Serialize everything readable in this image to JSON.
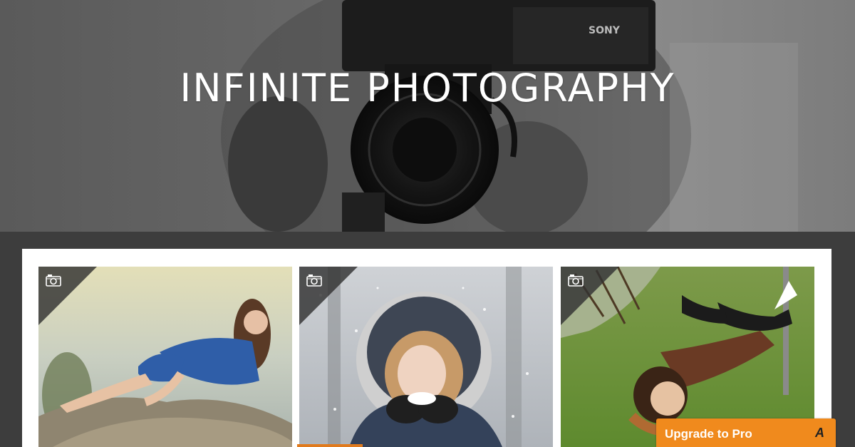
{
  "hero": {
    "title": "INFINITE PHOTOGRAPHY",
    "camera_brand": "SONY"
  },
  "gallery": {
    "items": [
      {
        "icon": "camera-icon",
        "description_color": "#7b8fa6"
      },
      {
        "icon": "camera-icon",
        "description_color": "#9aa3ad"
      },
      {
        "icon": "camera-icon",
        "description_color": "#5f8f3a"
      }
    ]
  },
  "upgrade": {
    "label": "Upgrade to Pro",
    "glyph": "A"
  },
  "colors": {
    "background": "#3d3d3d",
    "panel": "#ffffff",
    "accent": "#f08a1d"
  }
}
